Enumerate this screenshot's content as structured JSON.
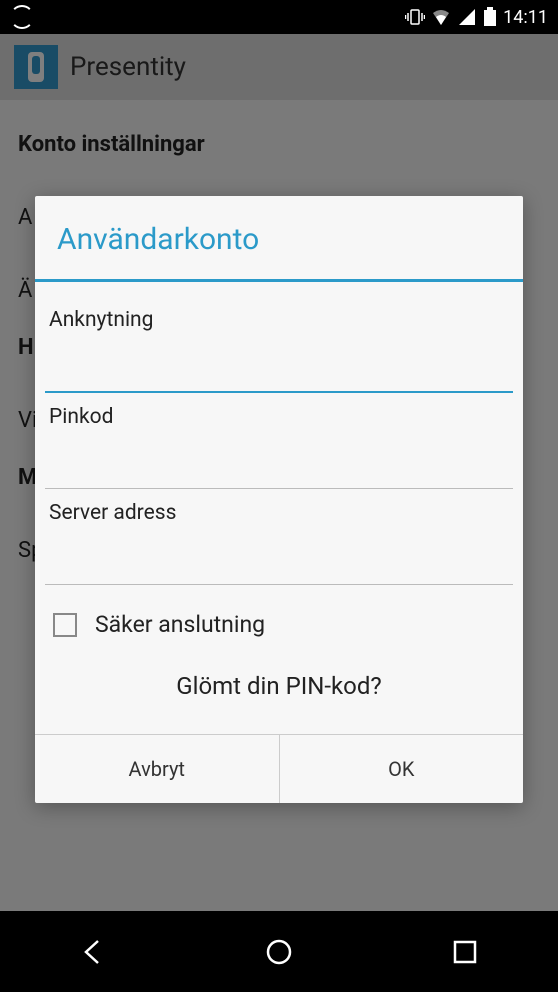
{
  "status": {
    "time": "14:11"
  },
  "app": {
    "title": "Presentity"
  },
  "page": {
    "section_title": "Konto inställningar",
    "rows": {
      "r1": "A",
      "r2": "Ä",
      "r3": "H",
      "r4": "Vi",
      "r5": "M",
      "r6": "Sp"
    }
  },
  "dialog": {
    "title": "Användarkonto",
    "fields": {
      "extension_label": "Anknytning",
      "extension_value": "",
      "pin_label": "Pinkod",
      "pin_value": "",
      "server_label": "Server adress",
      "server_value": ""
    },
    "secure_label": "Säker anslutning",
    "forgot_label": "Glömt din PIN-kod?",
    "cancel_label": "Avbryt",
    "ok_label": "OK"
  }
}
